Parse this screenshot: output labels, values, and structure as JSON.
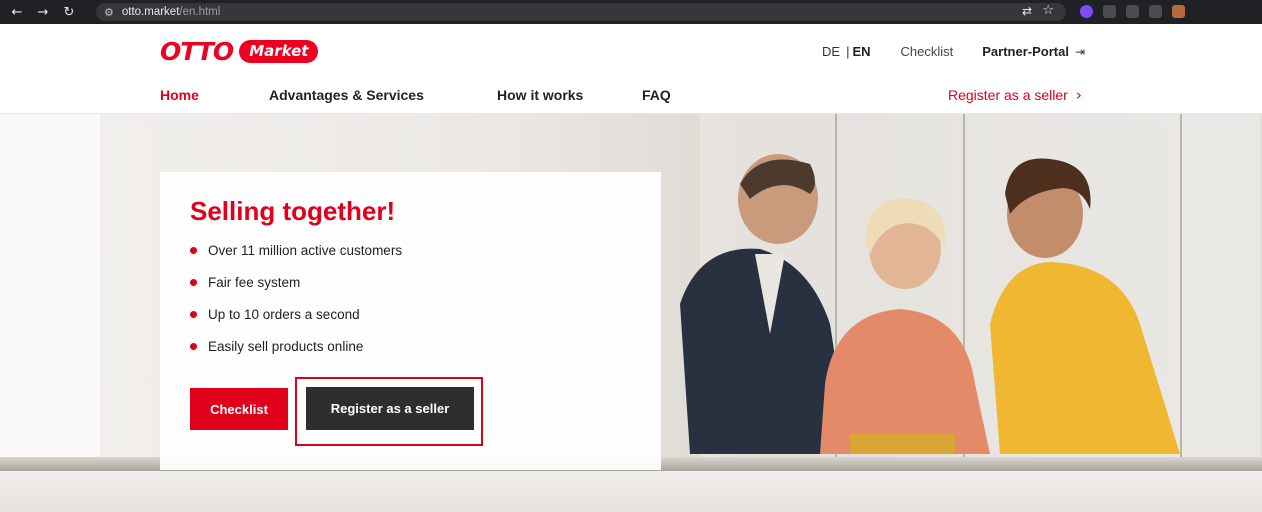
{
  "browser": {
    "url_host": "otto.market",
    "url_path": "/en.html"
  },
  "header": {
    "logo_otto": "OTTO",
    "logo_market": "Market",
    "lang_de": "DE",
    "lang_separator": "|",
    "lang_en": "EN",
    "checklist_link": "Checklist",
    "partner_portal": "Partner-Portal",
    "nav": [
      {
        "label": "Home",
        "active": true
      },
      {
        "label": "Advantages & Services",
        "active": false
      },
      {
        "label": "How it works",
        "active": false
      },
      {
        "label": "FAQ",
        "active": false
      }
    ],
    "register_link": "Register as a seller"
  },
  "hero": {
    "title": "Selling together!",
    "bullets": [
      "Over 11 million active customers",
      "Fair fee system",
      "Up to 10 orders a second",
      "Easily sell products online"
    ],
    "checklist_button": "Checklist",
    "register_button": "Register as a seller"
  },
  "colors": {
    "brand_red": "#e0001b",
    "dark_button": "#2e2e2e"
  }
}
